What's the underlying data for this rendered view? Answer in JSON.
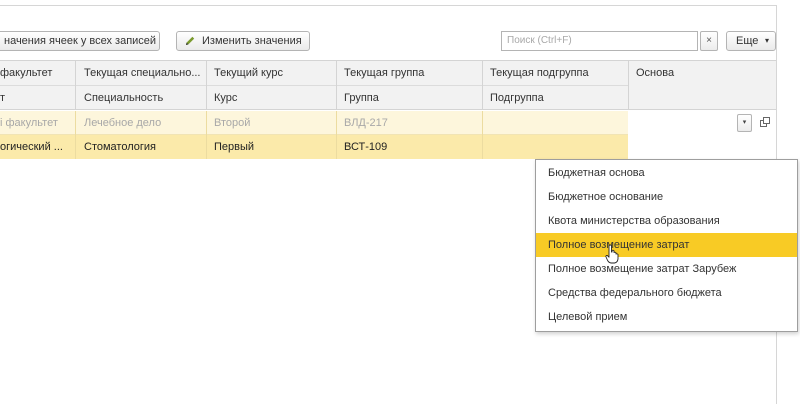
{
  "toolbar": {
    "set_values_label": "начения ячеек у всех записей",
    "change_values_label": "Изменить значения",
    "search_placeholder": "Поиск (Ctrl+F)",
    "clear_symbol": "×",
    "more_label": "Еще",
    "more_caret": "▾"
  },
  "table": {
    "header_top": [
      "факультет",
      "Текущая специально...",
      "Текущий курс",
      "Текущая группа",
      "Текущая подгруппа",
      "Основа"
    ],
    "header_bottom": [
      "т",
      "Специальность",
      "Курс",
      "Группа",
      "Подгруппа"
    ],
    "rows": [
      [
        "і факультет",
        "Лечебное дело",
        "Второй",
        "ВЛД-217",
        ""
      ],
      [
        "огический ...",
        "Стоматология",
        "Первый",
        "ВСТ-109",
        ""
      ]
    ]
  },
  "dropdown": {
    "drop_caret": "▾",
    "items": [
      "Бюджетная основа",
      "Бюджетное основание",
      "Квота министерства образования",
      "Полное возмещение затрат",
      "Полное возмещение затрат Зарубеж",
      "Средства федерального бюджета",
      "Целевой прием"
    ],
    "highlight_index": 3,
    "highlight_color": "#f8cb25"
  }
}
